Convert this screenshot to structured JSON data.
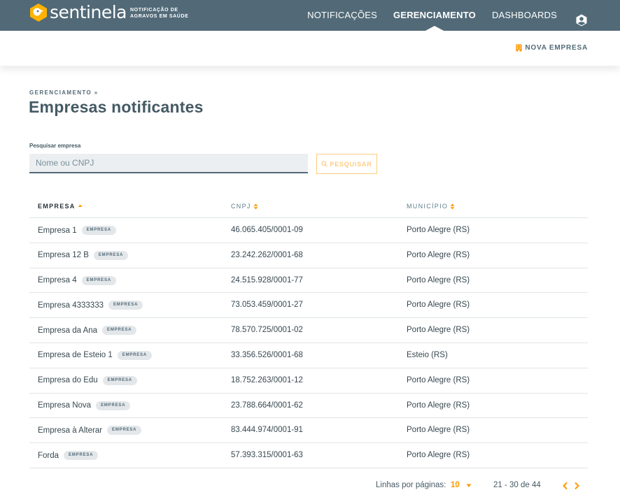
{
  "app": {
    "logo_text": "sentinela",
    "tagline": "Notificação de agravos em saúde"
  },
  "nav": {
    "items": [
      {
        "label": "NOTIFICAÇÕES",
        "active": false
      },
      {
        "label": "GERENCIAMENTO",
        "active": true
      },
      {
        "label": "DASHBOARDS",
        "active": false
      }
    ],
    "user_icon": "user-hexagon-icon"
  },
  "subheader": {
    "new_company_label": "NOVA EMPRESA",
    "new_company_icon": "building-icon"
  },
  "breadcrumb": "GERENCIAMENTO »",
  "page_title": "Empresas notificantes",
  "search": {
    "label": "Pesquisar empresa",
    "placeholder": "Nome ou CNPJ",
    "value": "",
    "button_label": "PESQUISAR"
  },
  "table": {
    "columns": [
      {
        "label": "EMPRESA",
        "sort": "asc"
      },
      {
        "label": "CNPJ",
        "sort": "none"
      },
      {
        "label": "MUNICÍPIO",
        "sort": "none"
      }
    ],
    "rows": [
      {
        "name": "Empresa 1",
        "badge": "EMPRESA",
        "cnpj": "46.065.405/0001-09",
        "city": "Porto Alegre (RS)"
      },
      {
        "name": "Empresa 12 B",
        "badge": "EMPRESA",
        "cnpj": "23.242.262/0001-68",
        "city": "Porto Alegre (RS)"
      },
      {
        "name": "Empresa 4",
        "badge": "EMPRESA",
        "cnpj": "24.515.928/0001-77",
        "city": "Porto Alegre (RS)"
      },
      {
        "name": "Empresa 4333333",
        "badge": "EMPRESA",
        "cnpj": "73.053.459/0001-27",
        "city": "Porto Alegre (RS)"
      },
      {
        "name": "Empresa da Ana",
        "badge": "EMPRESA",
        "cnpj": "78.570.725/0001-02",
        "city": "Porto Alegre (RS)"
      },
      {
        "name": "Empresa de Esteio 1",
        "badge": "EMPRESA",
        "cnpj": "33.356.526/0001-68",
        "city": "Esteio (RS)"
      },
      {
        "name": "Empresa do Edu",
        "badge": "EMPRESA",
        "cnpj": "18.752.263/0001-12",
        "city": "Porto Alegre (RS)"
      },
      {
        "name": "Empresa Nova",
        "badge": "EMPRESA",
        "cnpj": "23.788.664/0001-62",
        "city": "Porto Alegre (RS)"
      },
      {
        "name": "Empresa à Alterar",
        "badge": "EMPRESA",
        "cnpj": "83.444.974/0001-91",
        "city": "Porto Alegre (RS)"
      },
      {
        "name": "Forda",
        "badge": "EMPRESA",
        "cnpj": "57.393.315/0001-63",
        "city": "Porto Alegre (RS)"
      }
    ]
  },
  "pagination": {
    "rows_per_page_label": "Linhas por páginas:",
    "rows_per_page": "10",
    "range": "21 - 30 de 44"
  },
  "colors": {
    "header_bg": "#526a78",
    "accent": "#ff9800",
    "text": "#37474f"
  }
}
